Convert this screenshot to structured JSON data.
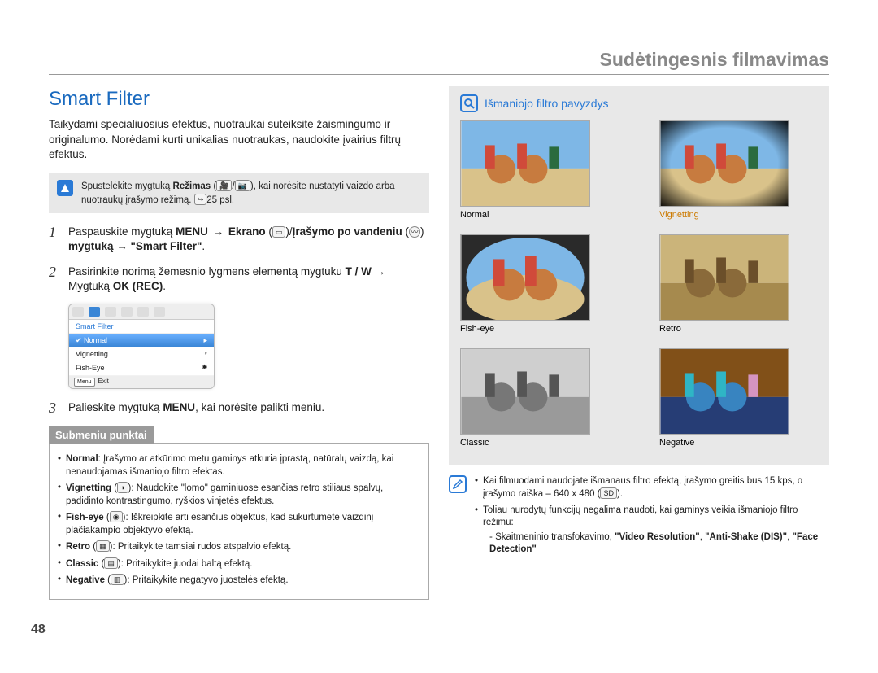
{
  "chapter": "Sudėtingesnis filmavimas",
  "pagenum": "48",
  "left": {
    "heading": "Smart Filter",
    "intro": "Taikydami specialiuosius efektus, nuotraukai suteiksite žaismingumo ir originalumo. Norėdami kurti unikalias nuotraukas, naudokite įvairius filtrų efektus.",
    "note_pre": "Spustelėkite mygtuką ",
    "note_bold": "Režimas",
    "note_icons": "🎥 / 📷",
    "note_post": ", kai norėsite nustatyti vaizdo arba nuotraukų įrašymo režimą. ",
    "note_ref": "25 psl.",
    "step1_a": "Paspauskite mygtuką ",
    "step1_menu": "MENU",
    "step1_b": " → ",
    "step1_ekrano": "Ekrano",
    "step1_slash": "/",
    "step1_irasymo": "Įrašymo po vandeniu",
    "step1_c": " mygtuką → ",
    "step1_smart": "\"Smart Filter\"",
    "step1_dot": ".",
    "step2_a": "Pasirinkite norimą žemesnio lygmens elementą mygtuku ",
    "step2_tw": "T / W",
    "step2_b": " → Mygtuką ",
    "step2_ok": "OK (REC)",
    "step2_dot": ".",
    "step3_a": "Palieskite mygtuką ",
    "step3_menu": "MENU",
    "step3_b": ", kai norėsite palikti meniu.",
    "miniui": {
      "title": "Smart Filter",
      "rows": [
        "Normal",
        "Vignetting",
        "Fish-Eye"
      ],
      "exit": "Exit",
      "menu_badge": "Menu"
    },
    "subhead": "Submeniu punktai",
    "sub": {
      "normal_b": "Normal",
      "normal_t": ": Įrašymo ar atkūrimo metu gaminys atkuria įprastą, natūralų vaizdą, kai nenaudojamas išmaniojo filtro efektas.",
      "vig_b": "Vignetting",
      "vig_t": ": Naudokite \"lomo\" gaminiuose esančias retro stiliaus spalvų, padidinto kontrastingumo, ryškios vinjetės efektus.",
      "fish_b": "Fish-eye",
      "fish_t": ": Iškreipkite arti esančius objektus, kad sukurtumėte vaizdinį plačiakampio objektyvo efektą.",
      "retro_b": "Retro",
      "retro_t": ": Pritaikykite tamsiai rudos atspalvio efektą.",
      "classic_b": "Classic",
      "classic_t": ": Pritaikykite juodai baltą efektą.",
      "neg_b": "Negative",
      "neg_t": ": Pritaikykite negatyvo juostelės efektą."
    }
  },
  "right": {
    "examplehead": "Išmaniojo filtro pavyzdys",
    "captions": [
      "Normal",
      "Vignetting",
      "Fish-eye",
      "Retro",
      "Classic",
      "Negative"
    ],
    "tip1_a": "Kai filmuodami naudojate išmanaus filtro efektą, įrašymo greitis bus 15 kps, o įrašymo raiška – 640 x 480 (",
    "tip1_sd": "SD",
    "tip1_b": ").",
    "tip2": "Toliau nurodytų funkcijų negalima naudoti, kai gaminys veikia išmaniojo filtro režimu:",
    "tip2_dash_a": "Skaitmeninio transfokavimo, ",
    "tip2_dash_b1": "\"Video Resolution\"",
    "tip2_dash_c": ", ",
    "tip2_dash_b2": "\"Anti-Shake (DIS)\"",
    "tip2_dash_d": ", ",
    "tip2_dash_b3": "\"Face Detection\""
  }
}
